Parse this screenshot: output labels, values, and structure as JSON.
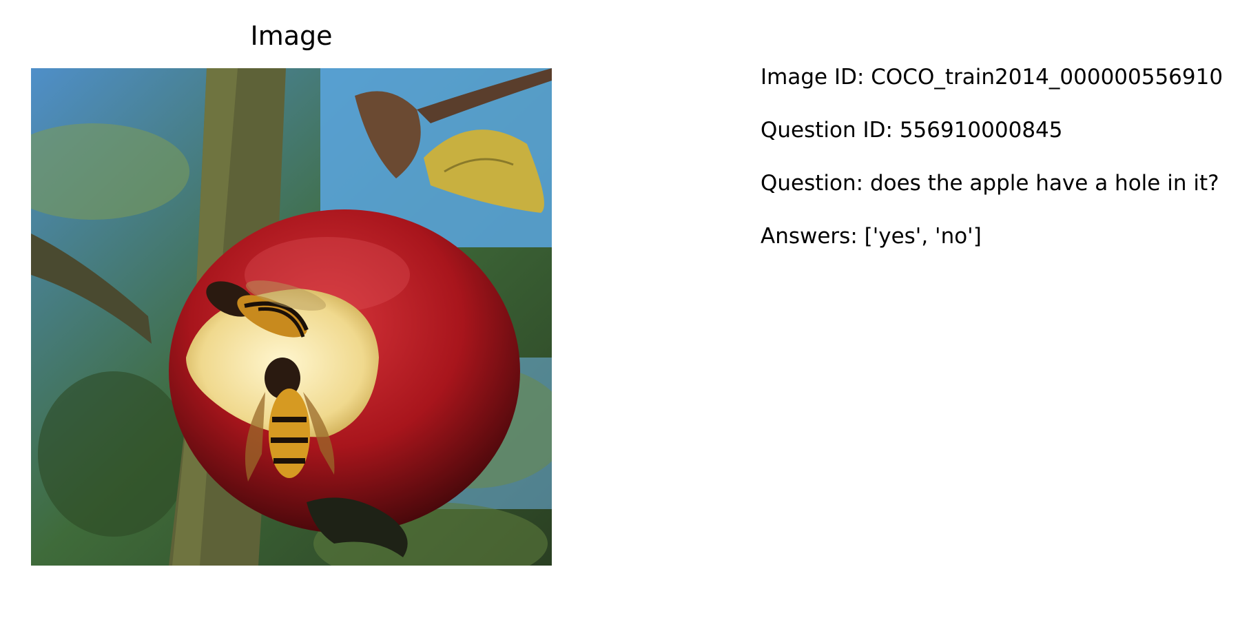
{
  "panel": {
    "title": "Image"
  },
  "photo": {
    "subject": "apple-with-wasps",
    "colors": {
      "sky": "#5aa6e0",
      "apple_red": "#b01a22",
      "apple_flesh": "#f6e7b0",
      "trunk": "#5e6238",
      "foliage": "#3d5a2a",
      "leaf_dry": "#c8b040"
    }
  },
  "info": {
    "image_id": "Image ID: COCO_train2014_000000556910",
    "question_id": "Question ID: 556910000845",
    "question": "Question: does the apple have a hole in it?",
    "answers": "Answers: ['yes', 'no']"
  }
}
